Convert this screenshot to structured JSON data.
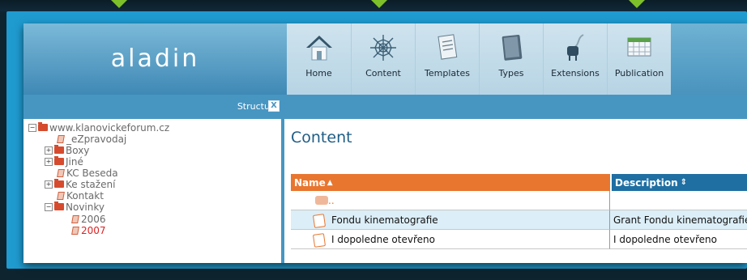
{
  "brand": {
    "logo": "aladin"
  },
  "nav": [
    {
      "label": "Home",
      "icon": "home-icon"
    },
    {
      "label": "Content",
      "icon": "spiderweb-icon"
    },
    {
      "label": "Templates",
      "icon": "document-icon"
    },
    {
      "label": "Types",
      "icon": "book-icon"
    },
    {
      "label": "Extensions",
      "icon": "plug-icon"
    },
    {
      "label": "Publication",
      "icon": "calendar-grid-icon"
    }
  ],
  "structure": {
    "title": "Structure",
    "close": "X"
  },
  "tree": [
    {
      "label": "www.klanovickeforum.cz",
      "toggle": "−",
      "kind": "folder",
      "level": 0
    },
    {
      "label": "_eZpravodaj",
      "kind": "page",
      "level": 1
    },
    {
      "label": "Boxy",
      "toggle": "+",
      "kind": "folder",
      "level": 1
    },
    {
      "label": "Jiné",
      "toggle": "+",
      "kind": "folder",
      "level": 1
    },
    {
      "label": "KC Beseda",
      "kind": "page",
      "level": 1
    },
    {
      "label": "Ke stažení",
      "toggle": "+",
      "kind": "folder",
      "level": 1
    },
    {
      "label": "Kontakt",
      "kind": "page",
      "level": 1
    },
    {
      "label": "Novinky",
      "toggle": "−",
      "kind": "folder",
      "level": 1
    },
    {
      "label": "2006",
      "kind": "page",
      "level": 2
    },
    {
      "label": "2007",
      "kind": "page",
      "level": 2,
      "active": true
    }
  ],
  "main": {
    "title": "Content",
    "columns": {
      "name": "Name",
      "name_sort": "▲",
      "description": "Description",
      "desc_sort": "⇕"
    },
    "up_row": "..",
    "rows": [
      {
        "name": "Fondu kinematografie",
        "description": "Grant Fondu kinematografie"
      },
      {
        "name": "I dopoledne otevřeno",
        "description": "I dopoledne otevřeno"
      }
    ]
  },
  "colors": {
    "accent_orange": "#e8762f",
    "header_blue": "#4796c2",
    "frame_blue": "#1f9bd0",
    "arrow_green": "#7ec02a"
  }
}
